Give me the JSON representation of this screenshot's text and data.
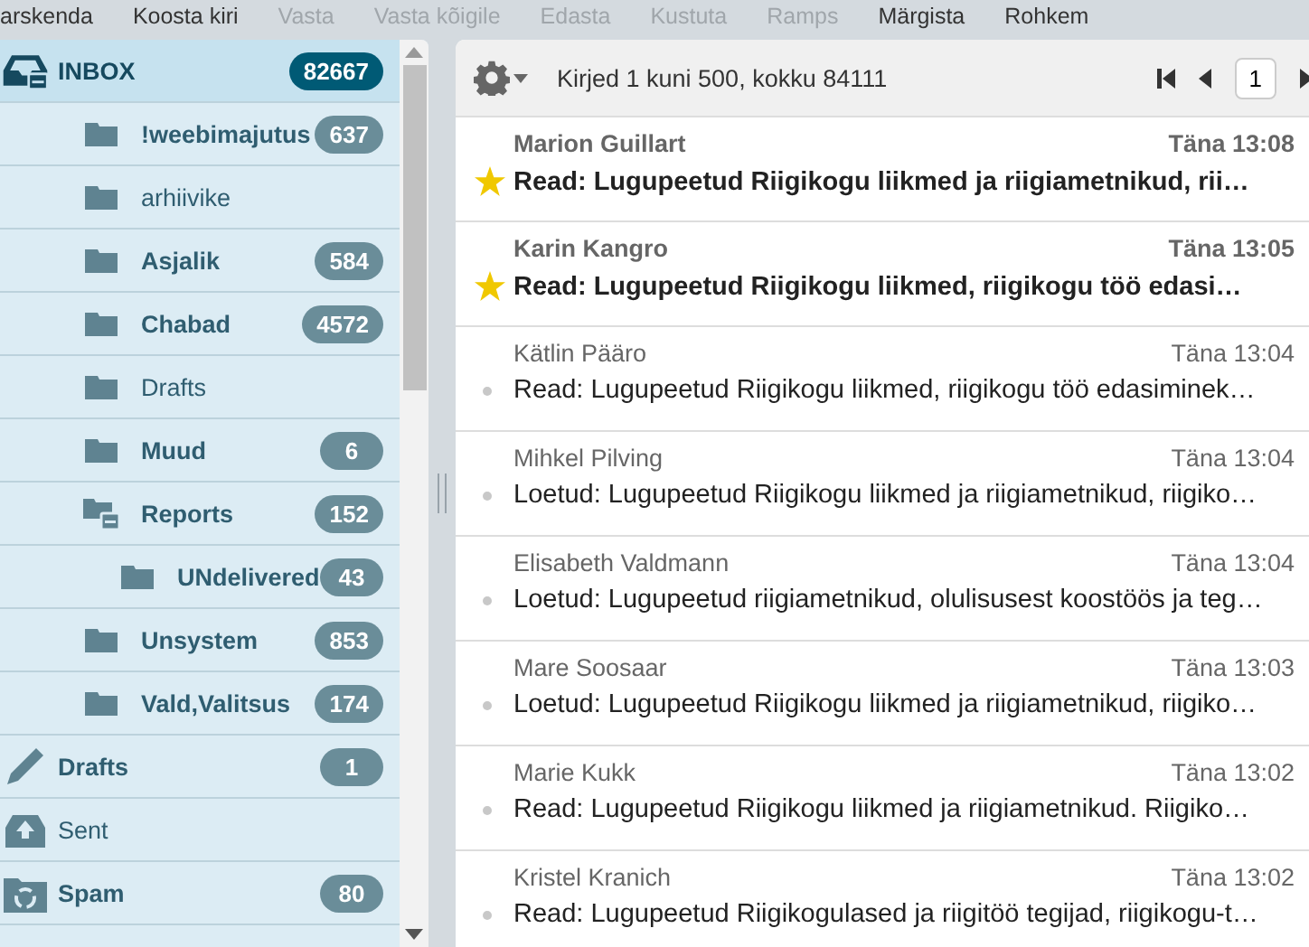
{
  "toolbar": [
    {
      "label": "arskenda",
      "disabled": false
    },
    {
      "label": "Koosta kiri",
      "disabled": false
    },
    {
      "label": "Vasta",
      "disabled": true
    },
    {
      "label": "Vasta kõigile",
      "disabled": true
    },
    {
      "label": "Edasta",
      "disabled": true
    },
    {
      "label": "Kustuta",
      "disabled": true
    },
    {
      "label": "Ramps",
      "disabled": true
    },
    {
      "label": "Märgista",
      "disabled": false
    },
    {
      "label": "Rohkem",
      "disabled": false
    }
  ],
  "folders": [
    {
      "name": "INBOX",
      "kind": "inbox",
      "count": "82667",
      "selected": true,
      "children": [
        {
          "name": "!weebimajutus",
          "kind": "folder",
          "count": "637",
          "selected": false
        },
        {
          "name": "arhiivike",
          "kind": "folder",
          "selected": false
        },
        {
          "name": "Asjalik",
          "kind": "folder",
          "count": "584",
          "selected": false
        },
        {
          "name": "Chabad",
          "kind": "folder",
          "count": "4572",
          "selected": false
        },
        {
          "name": "Drafts",
          "kind": "folder",
          "selected": false
        },
        {
          "name": "Muud",
          "kind": "folder",
          "count": "6",
          "selected": false
        },
        {
          "name": "Reports",
          "kind": "parent",
          "count": "152",
          "selected": false,
          "children": [
            {
              "name": "UNdelivered",
              "kind": "folder",
              "count": "43",
              "selected": false
            }
          ]
        },
        {
          "name": "Unsystem",
          "kind": "folder",
          "count": "853",
          "selected": false
        },
        {
          "name": "Vald,Valitsus",
          "kind": "folder",
          "count": "174",
          "selected": false
        }
      ]
    },
    {
      "name": "Drafts",
      "kind": "drafts",
      "count": "1",
      "selected": false
    },
    {
      "name": "Sent",
      "kind": "sent",
      "selected": false
    },
    {
      "name": "Spam",
      "kind": "spam",
      "count": "80",
      "selected": false
    }
  ],
  "list_header": {
    "summary": "Kirjed 1 kuni 500, kokku 84111",
    "page": "1"
  },
  "messages": [
    {
      "sender": "Marion Guillart",
      "date": "Täna 13:08",
      "subject": "Read: Lugupeetud Riigikogu liikmed ja riigiametnikud, rii…",
      "unread": true,
      "flagged": true
    },
    {
      "sender": "Karin Kangro",
      "date": "Täna 13:05",
      "subject": "Read: Lugupeetud Riigikogu liikmed, riigikogu töö edasi…",
      "unread": true,
      "flagged": true
    },
    {
      "sender": "Kätlin Pääro",
      "date": "Täna 13:04",
      "subject": "Read: Lugupeetud Riigikogu liikmed, riigikogu töö edasiminek…",
      "unread": false,
      "flagged": false
    },
    {
      "sender": "Mihkel Pilving",
      "date": "Täna 13:04",
      "subject": "Loetud: Lugupeetud Riigikogu liikmed ja riigiametnikud, riigiko…",
      "unread": false,
      "flagged": false
    },
    {
      "sender": "Elisabeth Valdmann",
      "date": "Täna 13:04",
      "subject": "Loetud: Lugupeetud riigiametnikud, olulisusest koostöös ja teg…",
      "unread": false,
      "flagged": false
    },
    {
      "sender": "Mare Soosaar",
      "date": "Täna 13:03",
      "subject": "Loetud: Lugupeetud Riigikogu liikmed ja riigiametnikud, riigiko…",
      "unread": false,
      "flagged": false
    },
    {
      "sender": "Marie Kukk",
      "date": "Täna 13:02",
      "subject": "Read: Lugupeetud Riigikogu liikmed ja riigiametnikud. Riigiko…",
      "unread": false,
      "flagged": false
    },
    {
      "sender": "Kristel Kranich",
      "date": "Täna 13:02",
      "subject": "Read: Lugupeetud Riigikogulased ja riigitöö tegijad, riigikogu-t…",
      "unread": false,
      "flagged": false
    }
  ]
}
